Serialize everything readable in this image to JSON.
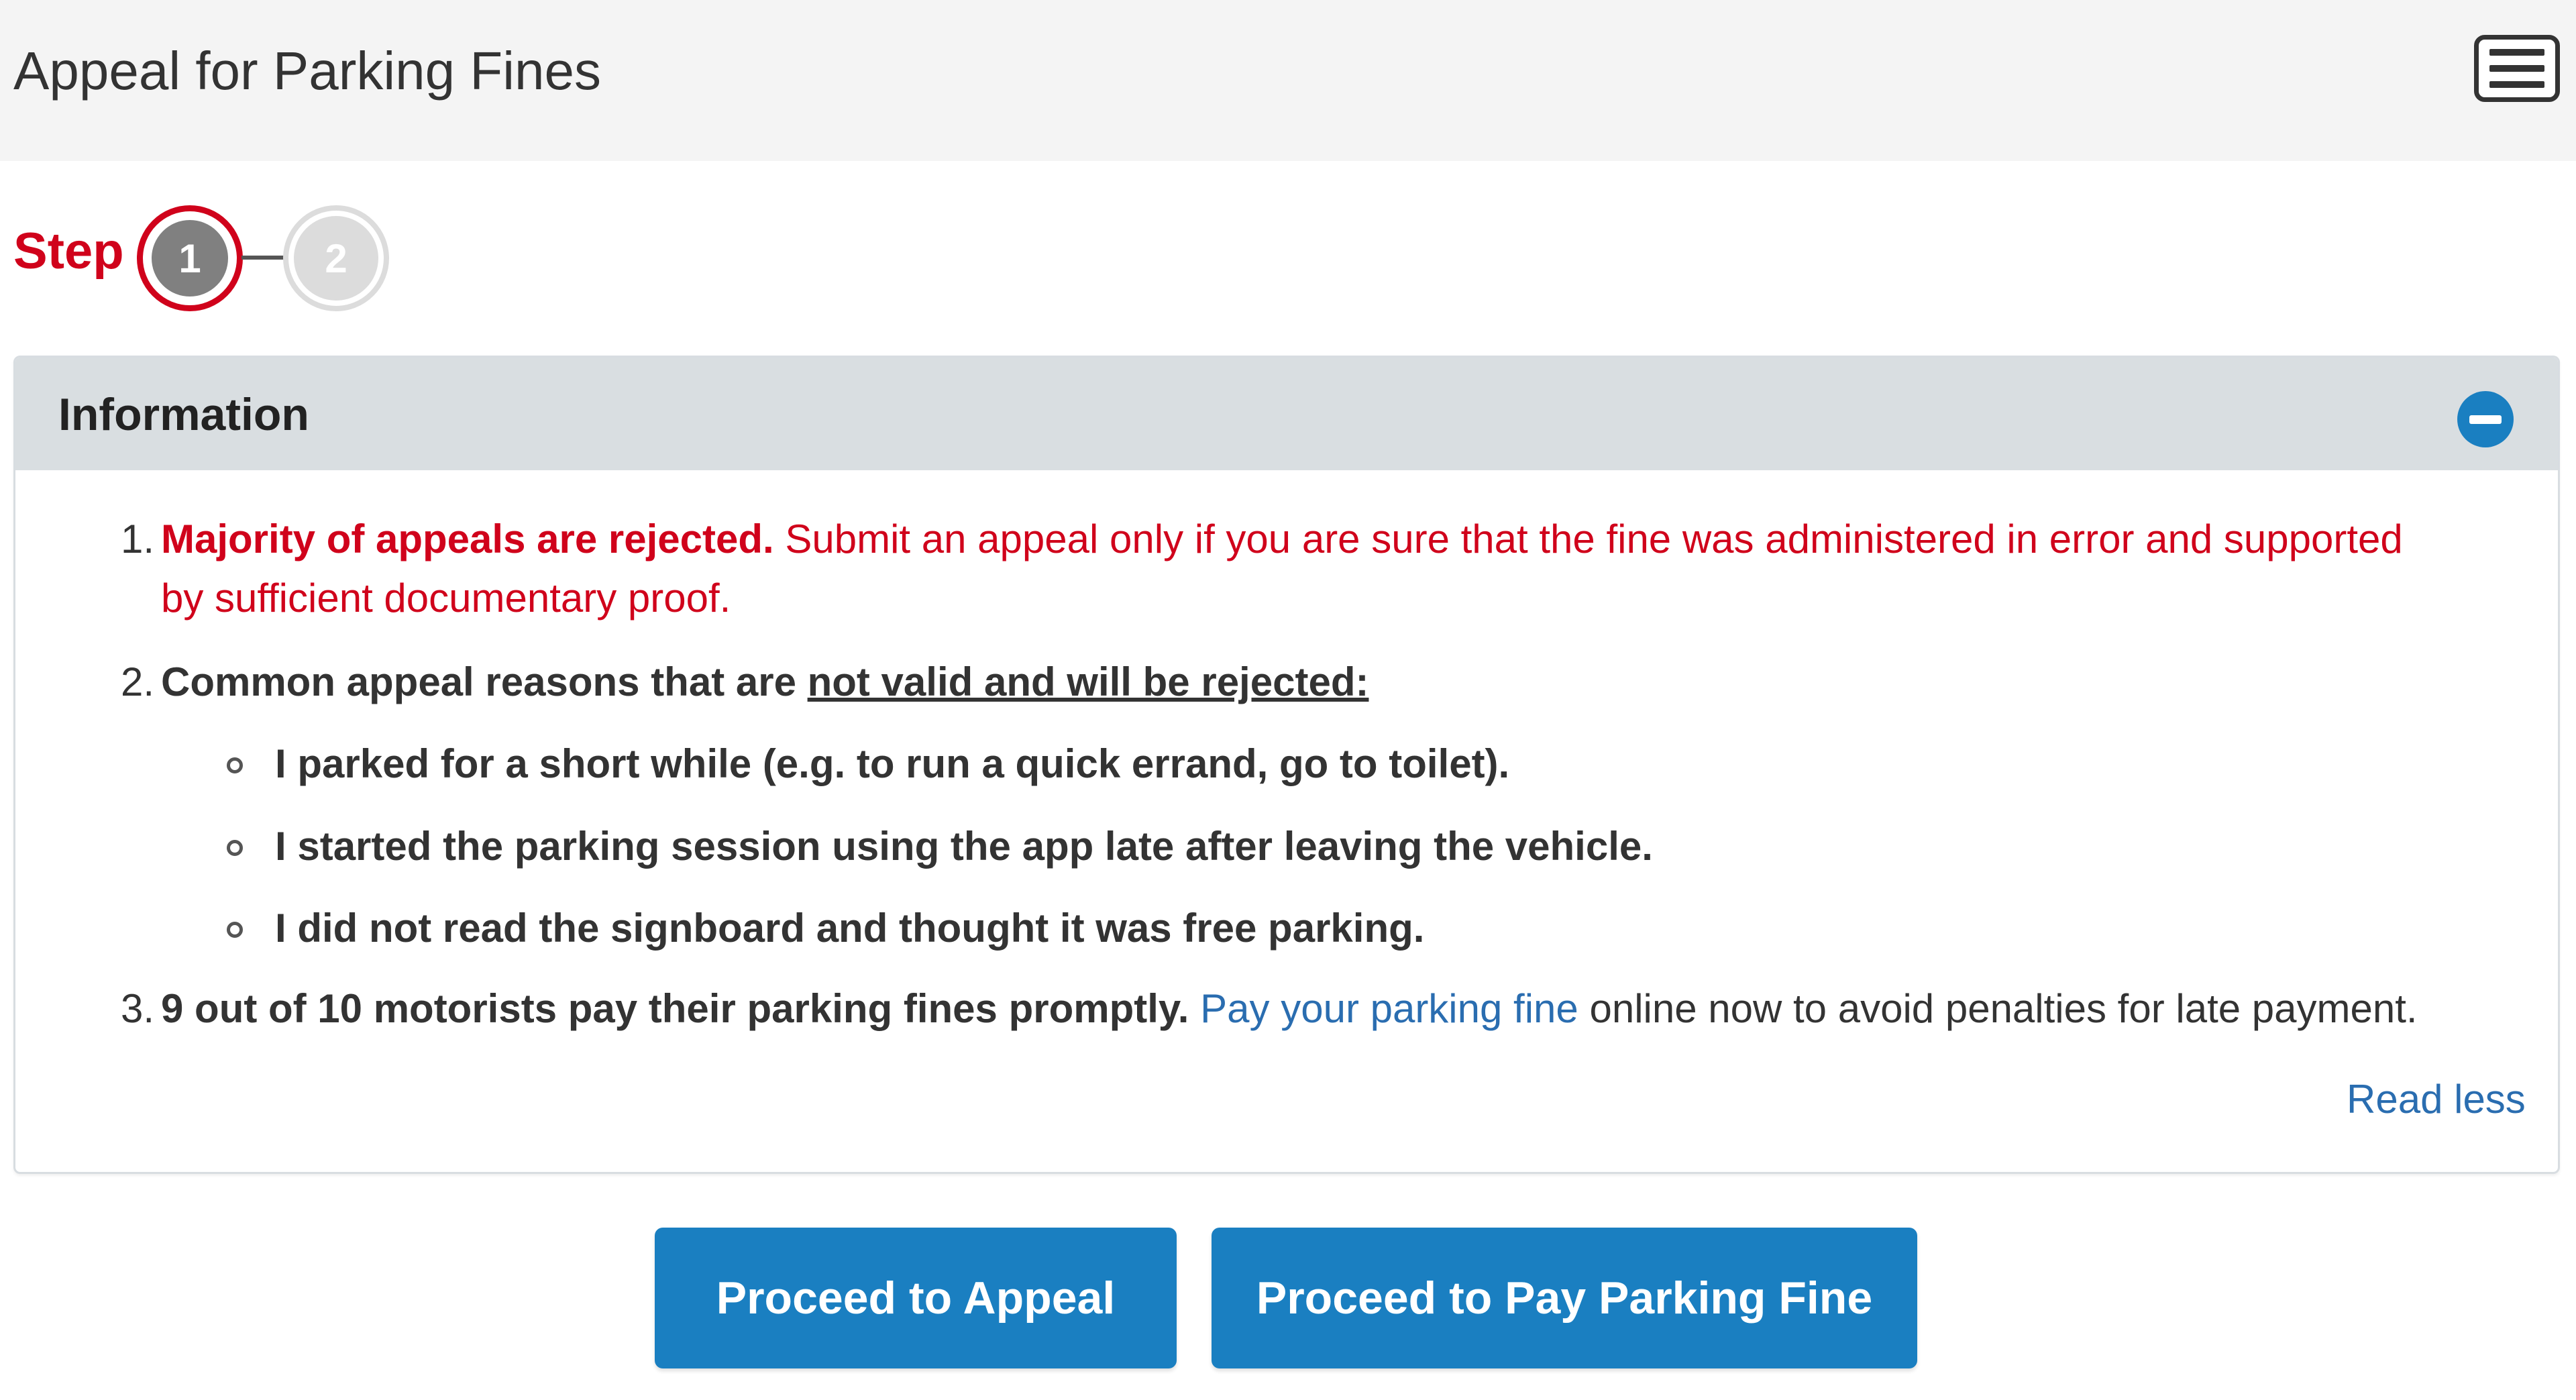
{
  "header": {
    "title": "Appeal for Parking Fines",
    "menu_icon": "hamburger-menu-icon"
  },
  "stepper": {
    "label": "Step",
    "steps": [
      {
        "number": "1",
        "state": "active"
      },
      {
        "number": "2",
        "state": "inactive"
      }
    ],
    "colors": {
      "accent": "#d0021b",
      "active_fill": "#808080",
      "inactive_fill": "#dcdcdc"
    }
  },
  "panel": {
    "title": "Information",
    "collapse_icon": "minus-circle-icon",
    "items": [
      {
        "number": "1.",
        "bold_text": "Majority of appeals are rejected.",
        "text": " Submit an appeal only if you are sure that the fine was administered in error and supported by sufficient documentary proof."
      },
      {
        "number": "2.",
        "text": "Common appeal reasons that are ",
        "underlined_text": "not valid and will be rejected:",
        "bullets": [
          "I parked for a short while (e.g. to run a quick errand, go to toilet).",
          "I started the parking session using the app late after leaving the vehicle.",
          "I did not read the signboard and thought it was free parking."
        ]
      },
      {
        "number": "3.",
        "bold_text": "9 out of 10 motorists pay their parking fines promptly.",
        "link_text": "Pay your parking fine",
        "text": " online now to avoid penalties for late payment."
      }
    ],
    "read_less": "Read less"
  },
  "actions": {
    "appeal_label": "Proceed to Appeal",
    "pay_label": "Proceed to Pay Parking Fine"
  },
  "colors": {
    "primary": "#1a7fc1",
    "link": "#2a6db0",
    "warning": "#d0021b",
    "header_bg": "#f4f4f4",
    "panel_header_bg": "#d9dee1"
  }
}
